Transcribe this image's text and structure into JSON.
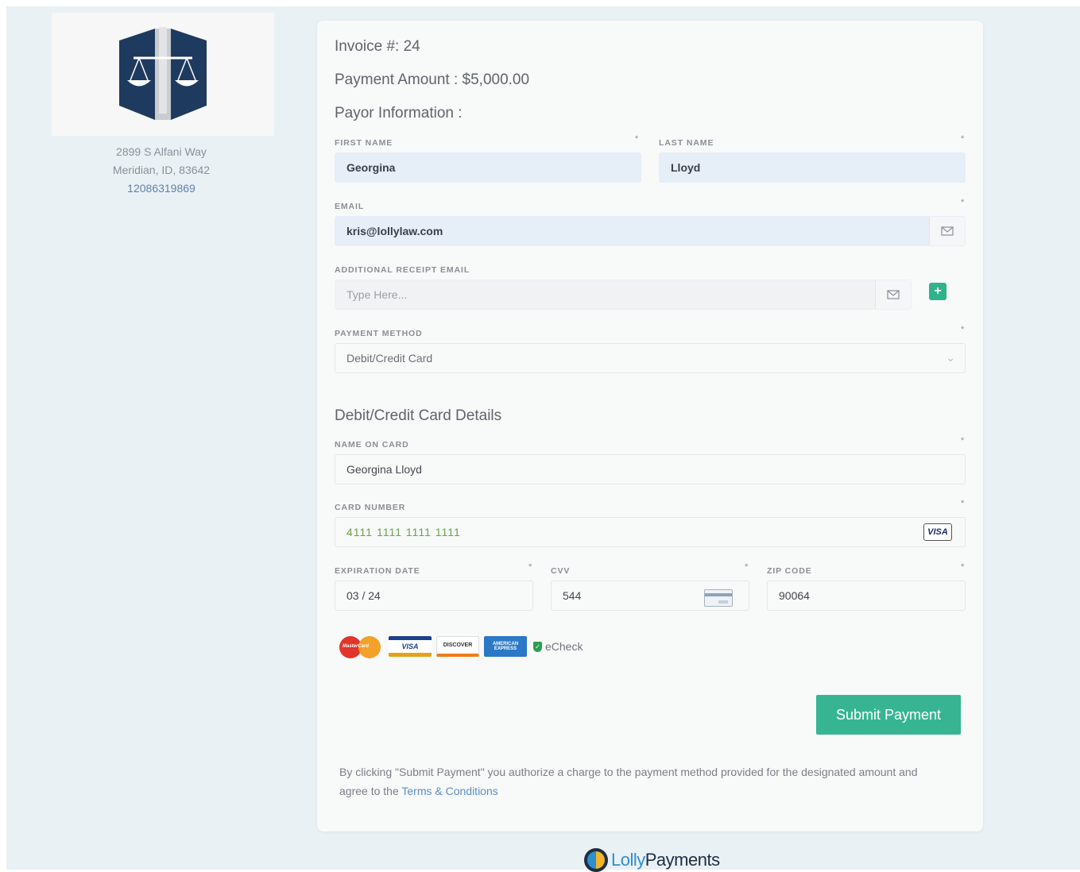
{
  "firm": {
    "address_line1": "2899 S Alfani Way",
    "address_line2": "Meridian, ID, 83642",
    "phone": "12086319869"
  },
  "invoice": {
    "number_label": "Invoice #: 24",
    "amount_label": "Payment Amount : $5,000.00",
    "payor_heading": "Payor Information :"
  },
  "form": {
    "first_name": {
      "label": "First Name",
      "value": "Georgina",
      "required": "*"
    },
    "last_name": {
      "label": "Last Name",
      "value": "Lloyd",
      "required": "*"
    },
    "email": {
      "label": "Email",
      "value": "kris@lollylaw.com",
      "required": "*"
    },
    "additional_email": {
      "label": "Additional Receipt Email",
      "placeholder": "Type Here..."
    },
    "payment_method": {
      "label": "Payment Method",
      "value": "Debit/Credit Card",
      "required": "*"
    }
  },
  "card_details": {
    "heading": "Debit/Credit Card Details",
    "name_on_card": {
      "label": "Name on Card",
      "value": "Georgina Lloyd",
      "required": "*"
    },
    "card_number": {
      "label": "Card Number",
      "value": "4111 1111 1111 1111",
      "brand": "VISA",
      "required": "*"
    },
    "expiration": {
      "label": "Expiration Date",
      "value": "03 / 24",
      "required": "*"
    },
    "cvv": {
      "label": "CVV",
      "value": "544",
      "required": "*"
    },
    "zip": {
      "label": "Zip Code",
      "value": "90064",
      "required": "*"
    }
  },
  "accepted": {
    "mastercard": "MasterCard",
    "visa": "VISA",
    "discover": "DISCOVER",
    "amex": "AMERICAN EXPRESS",
    "echeck": "eCheck"
  },
  "actions": {
    "submit_label": "Submit Payment"
  },
  "disclaimer": {
    "text": "By clicking \"Submit Payment\" you authorize a charge to the payment method provided for the designated amount and agree to the ",
    "link": "Terms & Conditions"
  },
  "footer": {
    "brand_part1": "Lolly",
    "brand_part2": "Payments"
  },
  "colors": {
    "accent": "#37b593",
    "background": "#eaf1f5",
    "navy": "#1f3a5f"
  }
}
